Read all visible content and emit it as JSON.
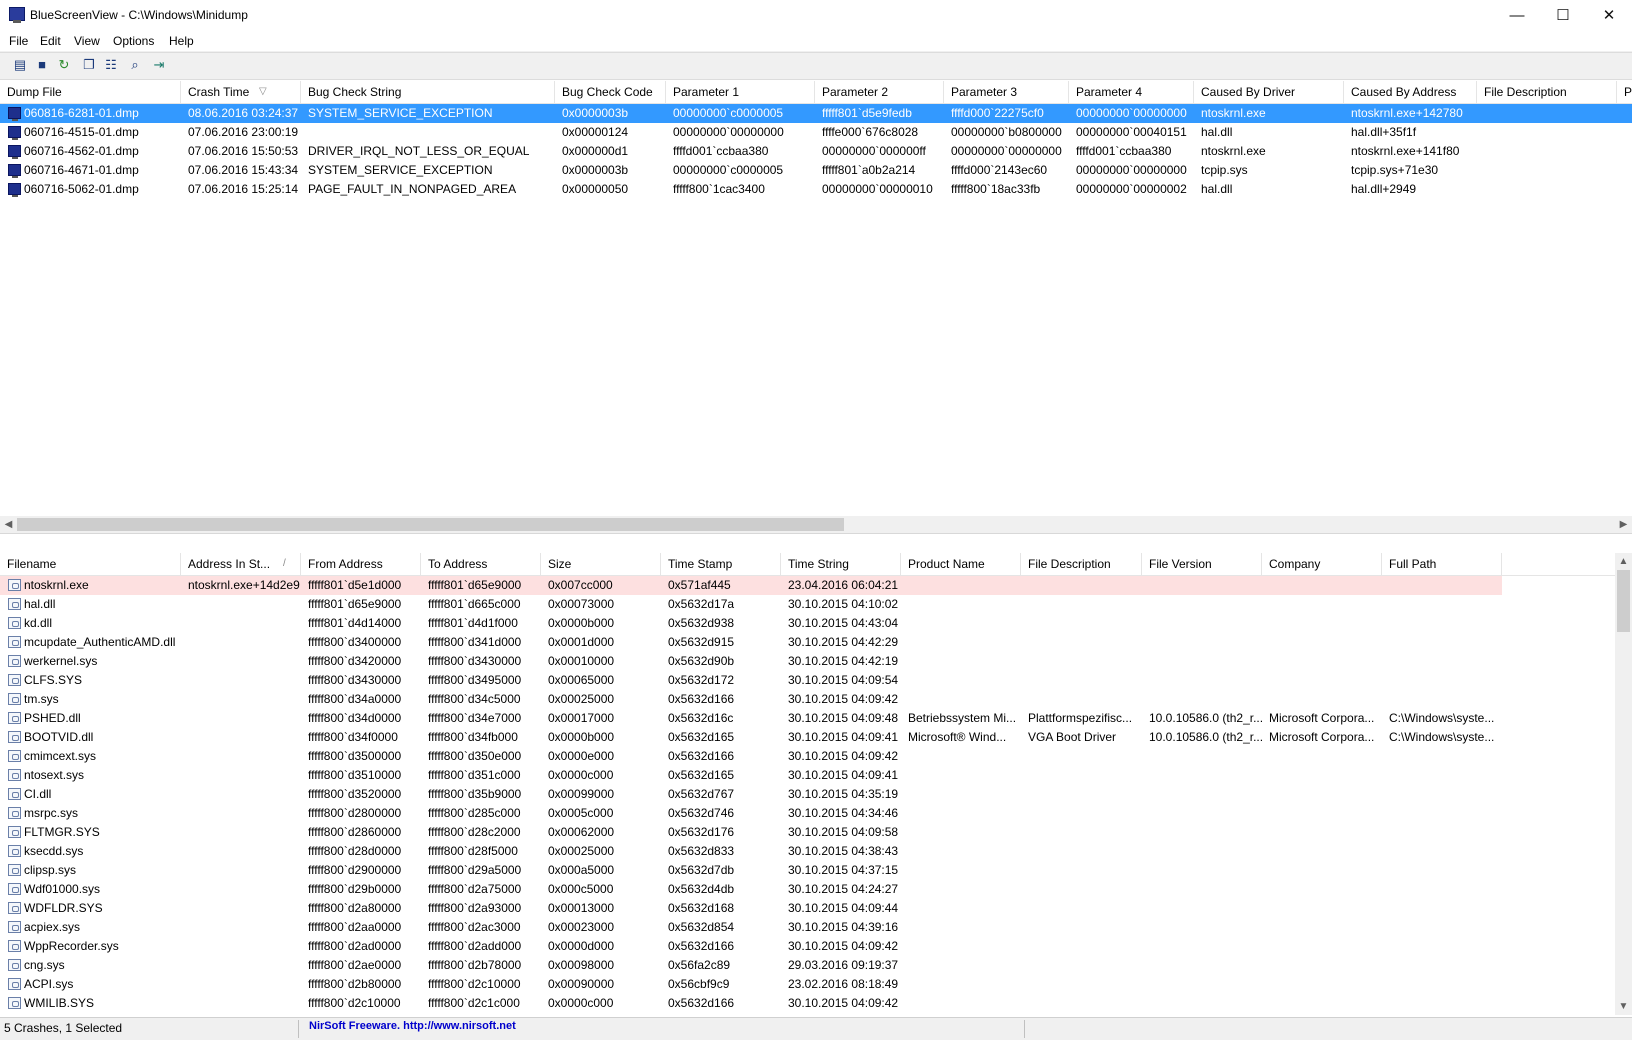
{
  "window": {
    "title": "BlueScreenView  -  C:\\Windows\\Minidump",
    "minimize_glyph": "—",
    "maximize_glyph": "☐",
    "close_glyph": "✕"
  },
  "menu": [
    "File",
    "Edit",
    "View",
    "Options",
    "Help"
  ],
  "toolbar_icons": [
    "html-report-icon",
    "save-icon",
    "refresh-icon",
    "copy-icon",
    "properties-icon",
    "find-icon",
    "exit-icon"
  ],
  "crash_list": {
    "columns": [
      "Dump File",
      "Crash Time",
      "Bug Check String",
      "Bug Check Code",
      "Parameter 1",
      "Parameter 2",
      "Parameter 3",
      "Parameter 4",
      "Caused By Driver",
      "Caused By Address",
      "File Description",
      "P"
    ],
    "sort_indicator": "▽",
    "rows": [
      [
        "060816-6281-01.dmp",
        "08.06.2016 03:24:37",
        "SYSTEM_SERVICE_EXCEPTION",
        "0x0000003b",
        "00000000`c0000005",
        "fffff801`d5e9fedb",
        "ffffd000`22275cf0",
        "00000000`00000000",
        "ntoskrnl.exe",
        "ntoskrnl.exe+142780"
      ],
      [
        "060716-4515-01.dmp",
        "07.06.2016 23:00:19",
        "",
        "0x00000124",
        "00000000`00000000",
        "ffffe000`676c8028",
        "00000000`b0800000",
        "00000000`00040151",
        "hal.dll",
        "hal.dll+35f1f"
      ],
      [
        "060716-4562-01.dmp",
        "07.06.2016 15:50:53",
        "DRIVER_IRQL_NOT_LESS_OR_EQUAL",
        "0x000000d1",
        "ffffd001`ccbaa380",
        "00000000`000000ff",
        "00000000`00000000",
        "ffffd001`ccbaa380",
        "ntoskrnl.exe",
        "ntoskrnl.exe+141f80"
      ],
      [
        "060716-4671-01.dmp",
        "07.06.2016 15:43:34",
        "SYSTEM_SERVICE_EXCEPTION",
        "0x0000003b",
        "00000000`c0000005",
        "fffff801`a0b2a214",
        "ffffd000`2143ec60",
        "00000000`00000000",
        "tcpip.sys",
        "tcpip.sys+71e30"
      ],
      [
        "060716-5062-01.dmp",
        "07.06.2016 15:25:14",
        "PAGE_FAULT_IN_NONPAGED_AREA",
        "0x00000050",
        "fffff800`1cac3400",
        "00000000`00000010",
        "fffff800`18ac33fb",
        "00000000`00000002",
        "hal.dll",
        "hal.dll+2949"
      ]
    ],
    "selected_index": 0
  },
  "module_list": {
    "columns": [
      "Filename",
      "Address In St...",
      "From Address",
      "To Address",
      "Size",
      "Time Stamp",
      "Time String",
      "Product Name",
      "File Description",
      "File Version",
      "Company",
      "Full Path"
    ],
    "sort_indicator": "/",
    "rows": [
      [
        "ntoskrnl.exe",
        "ntoskrnl.exe+14d2e9",
        "fffff801`d5e1d000",
        "fffff801`d65e9000",
        "0x007cc000",
        "0x571af445",
        "23.04.2016 06:04:21",
        "",
        "",
        "",
        "",
        ""
      ],
      [
        "hal.dll",
        "",
        "fffff801`d65e9000",
        "fffff801`d665c000",
        "0x00073000",
        "0x5632d17a",
        "30.10.2015 04:10:02",
        "",
        "",
        "",
        "",
        ""
      ],
      [
        "kd.dll",
        "",
        "fffff801`d4d14000",
        "fffff801`d4d1f000",
        "0x0000b000",
        "0x5632d938",
        "30.10.2015 04:43:04",
        "",
        "",
        "",
        "",
        ""
      ],
      [
        "mcupdate_AuthenticAMD.dll",
        "",
        "fffff800`d3400000",
        "fffff800`d341d000",
        "0x0001d000",
        "0x5632d915",
        "30.10.2015 04:42:29",
        "",
        "",
        "",
        "",
        ""
      ],
      [
        "werkernel.sys",
        "",
        "fffff800`d3420000",
        "fffff800`d3430000",
        "0x00010000",
        "0x5632d90b",
        "30.10.2015 04:42:19",
        "",
        "",
        "",
        "",
        ""
      ],
      [
        "CLFS.SYS",
        "",
        "fffff800`d3430000",
        "fffff800`d3495000",
        "0x00065000",
        "0x5632d172",
        "30.10.2015 04:09:54",
        "",
        "",
        "",
        "",
        ""
      ],
      [
        "tm.sys",
        "",
        "fffff800`d34a0000",
        "fffff800`d34c5000",
        "0x00025000",
        "0x5632d166",
        "30.10.2015 04:09:42",
        "",
        "",
        "",
        "",
        ""
      ],
      [
        "PSHED.dll",
        "",
        "fffff800`d34d0000",
        "fffff800`d34e7000",
        "0x00017000",
        "0x5632d16c",
        "30.10.2015 04:09:48",
        "Betriebssystem Mi...",
        "Plattformspezifisc...",
        "10.0.10586.0 (th2_r...",
        "Microsoft Corpora...",
        "C:\\Windows\\syste..."
      ],
      [
        "BOOTVID.dll",
        "",
        "fffff800`d34f0000",
        "fffff800`d34fb000",
        "0x0000b000",
        "0x5632d165",
        "30.10.2015 04:09:41",
        "Microsoft® Wind...",
        "VGA Boot Driver",
        "10.0.10586.0 (th2_r...",
        "Microsoft Corpora...",
        "C:\\Windows\\syste..."
      ],
      [
        "cmimcext.sys",
        "",
        "fffff800`d3500000",
        "fffff800`d350e000",
        "0x0000e000",
        "0x5632d166",
        "30.10.2015 04:09:42",
        "",
        "",
        "",
        "",
        ""
      ],
      [
        "ntosext.sys",
        "",
        "fffff800`d3510000",
        "fffff800`d351c000",
        "0x0000c000",
        "0x5632d165",
        "30.10.2015 04:09:41",
        "",
        "",
        "",
        "",
        ""
      ],
      [
        "CI.dll",
        "",
        "fffff800`d3520000",
        "fffff800`d35b9000",
        "0x00099000",
        "0x5632d767",
        "30.10.2015 04:35:19",
        "",
        "",
        "",
        "",
        ""
      ],
      [
        "msrpc.sys",
        "",
        "fffff800`d2800000",
        "fffff800`d285c000",
        "0x0005c000",
        "0x5632d746",
        "30.10.2015 04:34:46",
        "",
        "",
        "",
        "",
        ""
      ],
      [
        "FLTMGR.SYS",
        "",
        "fffff800`d2860000",
        "fffff800`d28c2000",
        "0x00062000",
        "0x5632d176",
        "30.10.2015 04:09:58",
        "",
        "",
        "",
        "",
        ""
      ],
      [
        "ksecdd.sys",
        "",
        "fffff800`d28d0000",
        "fffff800`d28f5000",
        "0x00025000",
        "0x5632d833",
        "30.10.2015 04:38:43",
        "",
        "",
        "",
        "",
        ""
      ],
      [
        "clipsp.sys",
        "",
        "fffff800`d2900000",
        "fffff800`d29a5000",
        "0x000a5000",
        "0x5632d7db",
        "30.10.2015 04:37:15",
        "",
        "",
        "",
        "",
        ""
      ],
      [
        "Wdf01000.sys",
        "",
        "fffff800`d29b0000",
        "fffff800`d2a75000",
        "0x000c5000",
        "0x5632d4db",
        "30.10.2015 04:24:27",
        "",
        "",
        "",
        "",
        ""
      ],
      [
        "WDFLDR.SYS",
        "",
        "fffff800`d2a80000",
        "fffff800`d2a93000",
        "0x00013000",
        "0x5632d168",
        "30.10.2015 04:09:44",
        "",
        "",
        "",
        "",
        ""
      ],
      [
        "acpiex.sys",
        "",
        "fffff800`d2aa0000",
        "fffff800`d2ac3000",
        "0x00023000",
        "0x5632d854",
        "30.10.2015 04:39:16",
        "",
        "",
        "",
        "",
        ""
      ],
      [
        "WppRecorder.sys",
        "",
        "fffff800`d2ad0000",
        "fffff800`d2add000",
        "0x0000d000",
        "0x5632d166",
        "30.10.2015 04:09:42",
        "",
        "",
        "",
        "",
        ""
      ],
      [
        "cng.sys",
        "",
        "fffff800`d2ae0000",
        "fffff800`d2b78000",
        "0x00098000",
        "0x56fa2c89",
        "29.03.2016 09:19:37",
        "",
        "",
        "",
        "",
        ""
      ],
      [
        "ACPI.sys",
        "",
        "fffff800`d2b80000",
        "fffff800`d2c10000",
        "0x00090000",
        "0x56cbf9c9",
        "23.02.2016 08:18:49",
        "",
        "",
        "",
        "",
        ""
      ],
      [
        "WMILIB.SYS",
        "",
        "fffff800`d2c10000",
        "fffff800`d2c1c000",
        "0x0000c000",
        "0x5632d166",
        "30.10.2015 04:09:42",
        "",
        "",
        "",
        "",
        ""
      ]
    ],
    "highlighted_index": 0
  },
  "status": {
    "crashes": "5 Crashes, 1 Selected",
    "freeware": "NirSoft Freeware.  http://www.nirsoft.net"
  },
  "colors": {
    "selection": "#3399ff",
    "highlight_row": "#fde0e0",
    "link": "#0000cc"
  }
}
